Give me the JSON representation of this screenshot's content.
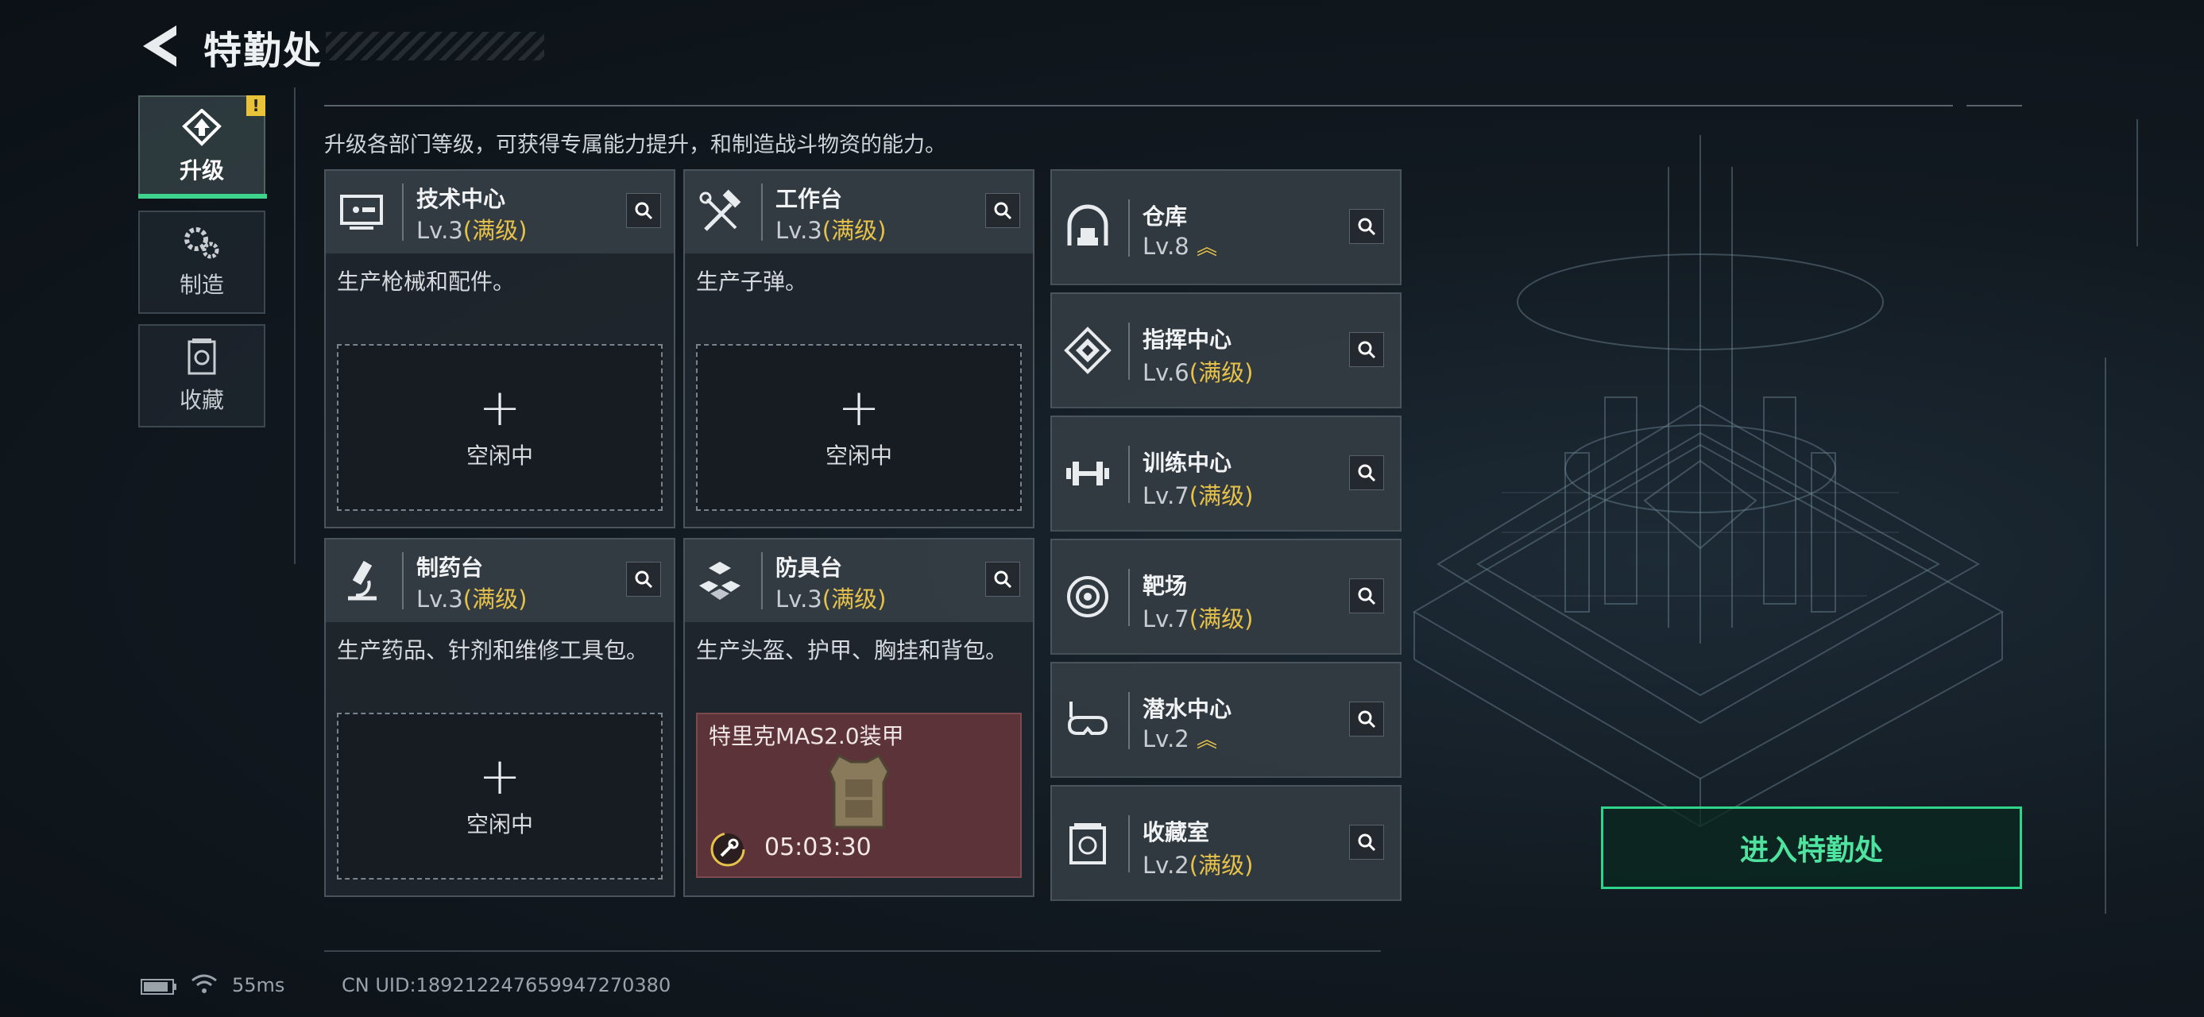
{
  "header": {
    "title": "特勤处"
  },
  "nav": [
    {
      "label": "升级",
      "icon": "upgrade-icon",
      "active": true,
      "badge": "!"
    },
    {
      "label": "制造",
      "icon": "gears-icon",
      "active": false
    },
    {
      "label": "收藏",
      "icon": "collection-icon",
      "active": false
    }
  ],
  "subtitle": "升级各部门等级，可获得专属能力提升，和制造战斗物资的能力。",
  "cards": [
    {
      "name": "技术中心",
      "level": "Lv.3",
      "status": "(满级)",
      "desc": "生产枪械和配件。",
      "slot_plus": "+",
      "slot_label": "空闲中"
    },
    {
      "name": "工作台",
      "level": "Lv.3",
      "status": "(满级)",
      "desc": "生产子弹。",
      "slot_plus": "+",
      "slot_label": "空闲中"
    },
    {
      "name": "制药台",
      "level": "Lv.3",
      "status": "(满级)",
      "desc": "生产药品、针剂和维修工具包。",
      "slot_plus": "+",
      "slot_label": "空闲中"
    },
    {
      "name": "防具台",
      "level": "Lv.3",
      "status": "(满级)",
      "desc": "生产头盔、护甲、胸挂和背包。",
      "craft_item": "特里克MAS2.0装甲",
      "craft_time": "05:03:30"
    }
  ],
  "rooms": [
    {
      "name": "仓库",
      "level": "Lv.8",
      "status": "",
      "upgradable": true
    },
    {
      "name": "指挥中心",
      "level": "Lv.6",
      "status": "(满级)"
    },
    {
      "name": "训练中心",
      "level": "Lv.7",
      "status": "(满级)"
    },
    {
      "name": "靶场",
      "level": "Lv.7",
      "status": "(满级)"
    },
    {
      "name": "潜水中心",
      "level": "Lv.2",
      "status": "",
      "upgradable": true
    },
    {
      "name": "收藏室",
      "level": "Lv.2",
      "status": "(满级)"
    }
  ],
  "enter_button": "进入特勤处",
  "status_bar": {
    "ping": "55ms",
    "uid": "CN UID:189212247659947270380"
  },
  "colors": {
    "accent_green": "#3fd48d",
    "max_level": "#e7c24a",
    "crafting_bg": "#5c3338"
  }
}
